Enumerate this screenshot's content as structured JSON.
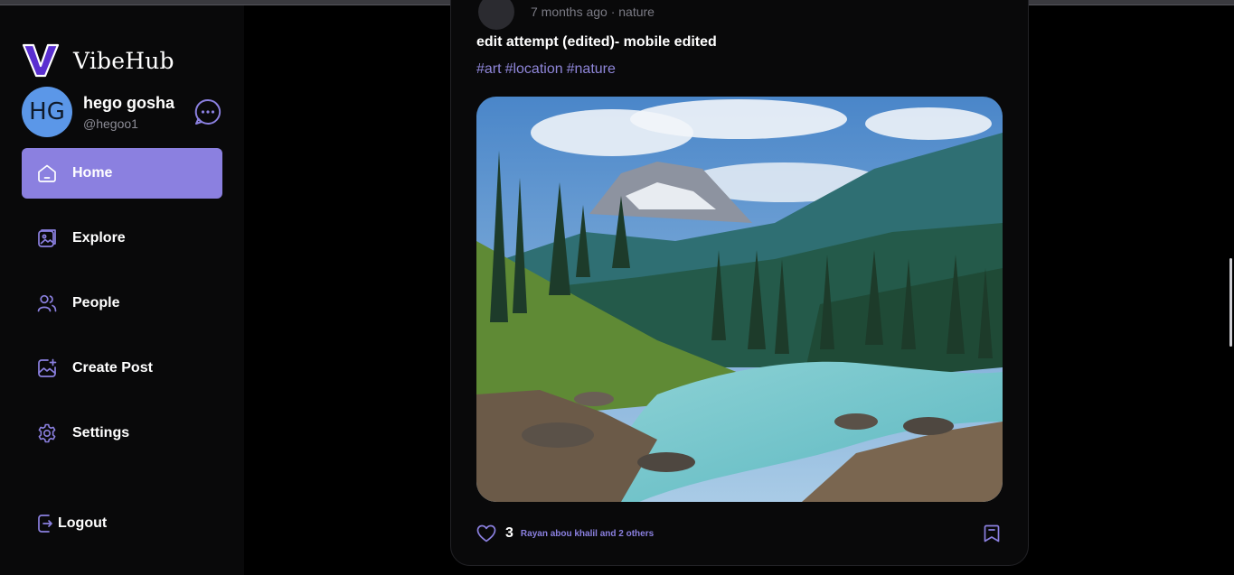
{
  "brand": {
    "name": "VibeHub",
    "logo_letter": "V"
  },
  "profile": {
    "initials": "HG",
    "name": "hego gosha",
    "handle": "@hegoo1"
  },
  "nav": {
    "items": [
      {
        "label": "Home",
        "icon": "home-icon",
        "active": true
      },
      {
        "label": "Explore",
        "icon": "explore-icon",
        "active": false
      },
      {
        "label": "People",
        "icon": "people-icon",
        "active": false
      },
      {
        "label": "Create Post",
        "icon": "create-post-icon",
        "active": false
      },
      {
        "label": "Settings",
        "icon": "settings-icon",
        "active": false
      }
    ],
    "logout_label": "Logout"
  },
  "post": {
    "meta": "7 months ago · nature",
    "text": "edit attempt (edited)- mobile edited",
    "tags": [
      "#art",
      "#location",
      "#nature"
    ],
    "like_count": "3",
    "liked_by": "Rayan abou khalil and 2 others"
  },
  "colors": {
    "accent": "#8b80e0",
    "sidebar_bg": "#09090a",
    "page_bg": "#000000",
    "avatar": "#5b97e8"
  }
}
